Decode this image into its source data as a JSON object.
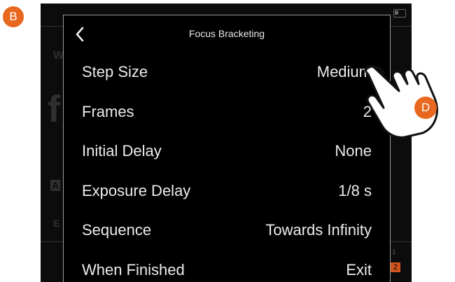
{
  "markers": {
    "b": "B",
    "d": "D"
  },
  "background": {
    "left_glyphs": [
      "W",
      "f",
      "A",
      "E"
    ],
    "right_badge_number": "1",
    "right_badge_value": "2"
  },
  "panel": {
    "title": "Focus Bracketing",
    "back_icon": "chevron-left-icon",
    "rows": [
      {
        "label": "Step Size",
        "value": "Medium"
      },
      {
        "label": "Frames",
        "value": "2"
      },
      {
        "label": "Initial Delay",
        "value": "None"
      },
      {
        "label": "Exposure Delay",
        "value": "1/8 s"
      },
      {
        "label": "Sequence",
        "value": "Towards Infinity"
      },
      {
        "label": "When Finished",
        "value": "Exit"
      }
    ]
  },
  "colors": {
    "marker": "#e8681f",
    "panel_border": "#9a9a9a",
    "badge": "#d2531d"
  }
}
